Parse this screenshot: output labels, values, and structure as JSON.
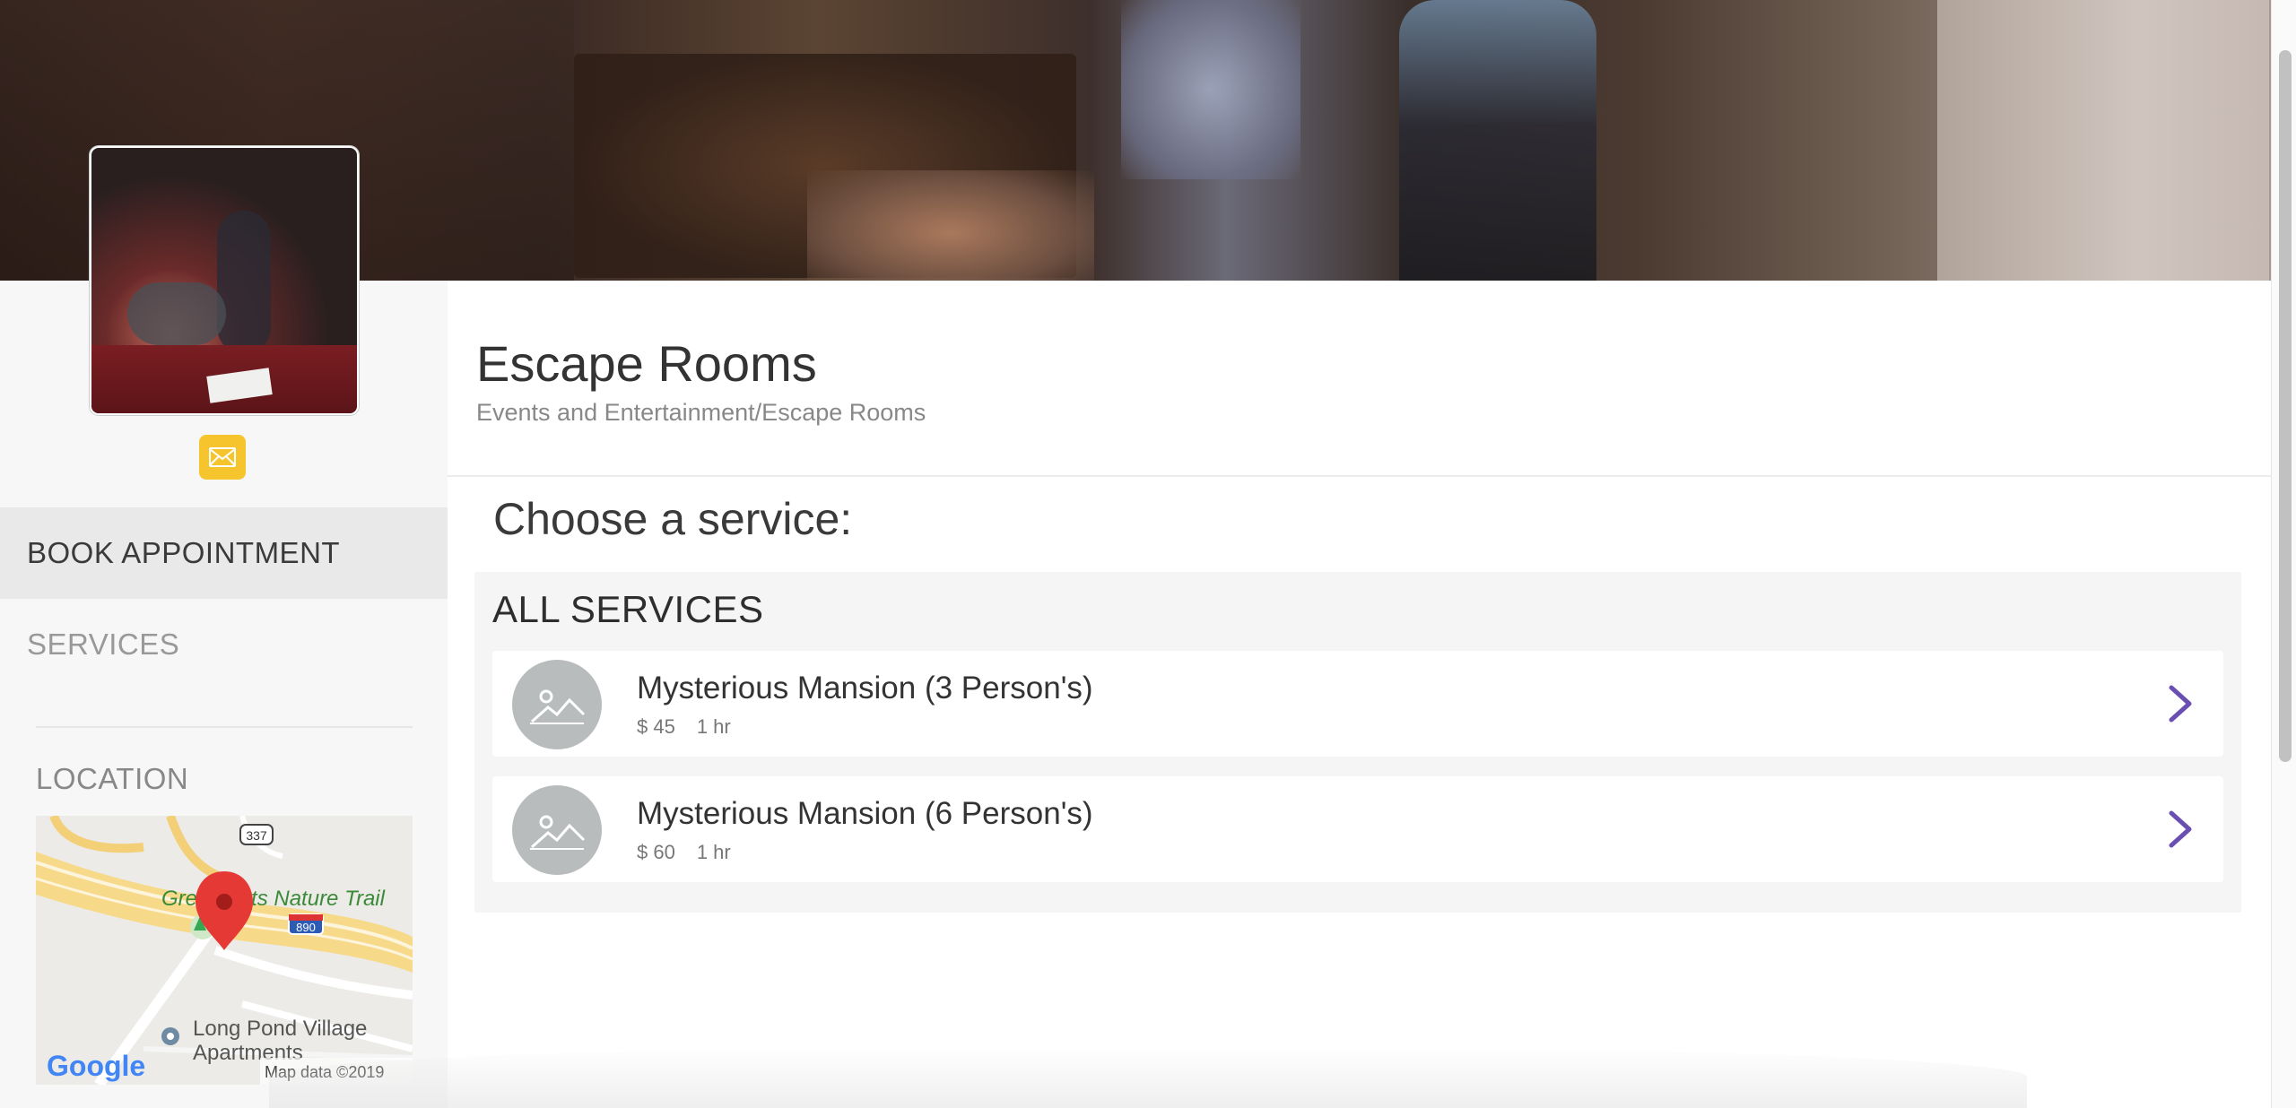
{
  "header": {
    "banner_image": "escape-room-banner"
  },
  "sidebar": {
    "profile_image": "escape-room-profile-photo",
    "mail_icon": "envelope-icon",
    "nav": [
      {
        "label": "BOOK APPOINTMENT",
        "active": true
      },
      {
        "label": "SERVICES",
        "active": false
      }
    ],
    "location_label": "LOCATION",
    "map": {
      "labels": {
        "trail": "Great Flats Nature Trail",
        "route_337": "337",
        "route_890": "890",
        "apartments_line1": "Long Pond Village",
        "apartments_line2": "Apartments",
        "logo": "Google",
        "attribution": "Map data ©2019"
      }
    }
  },
  "main": {
    "title": "Escape Rooms",
    "category": "Events and Entertainment/Escape Rooms",
    "choose_label": "Choose a service:",
    "services_section": {
      "heading": "ALL SERVICES",
      "items": [
        {
          "name": "Mysterious Mansion (3 Person's)",
          "price": "$ 45",
          "duration": "1 hr",
          "icon": "image-placeholder-icon"
        },
        {
          "name": "Mysterious Mansion (6 Person's)",
          "price": "$ 60",
          "duration": "1 hr",
          "icon": "image-placeholder-icon"
        }
      ]
    }
  },
  "colors": {
    "accent_yellow": "#f6c52d",
    "chevron_purple": "#6a4fb3",
    "active_nav_bg": "#e9e9e9",
    "marker_red": "#e53935"
  }
}
